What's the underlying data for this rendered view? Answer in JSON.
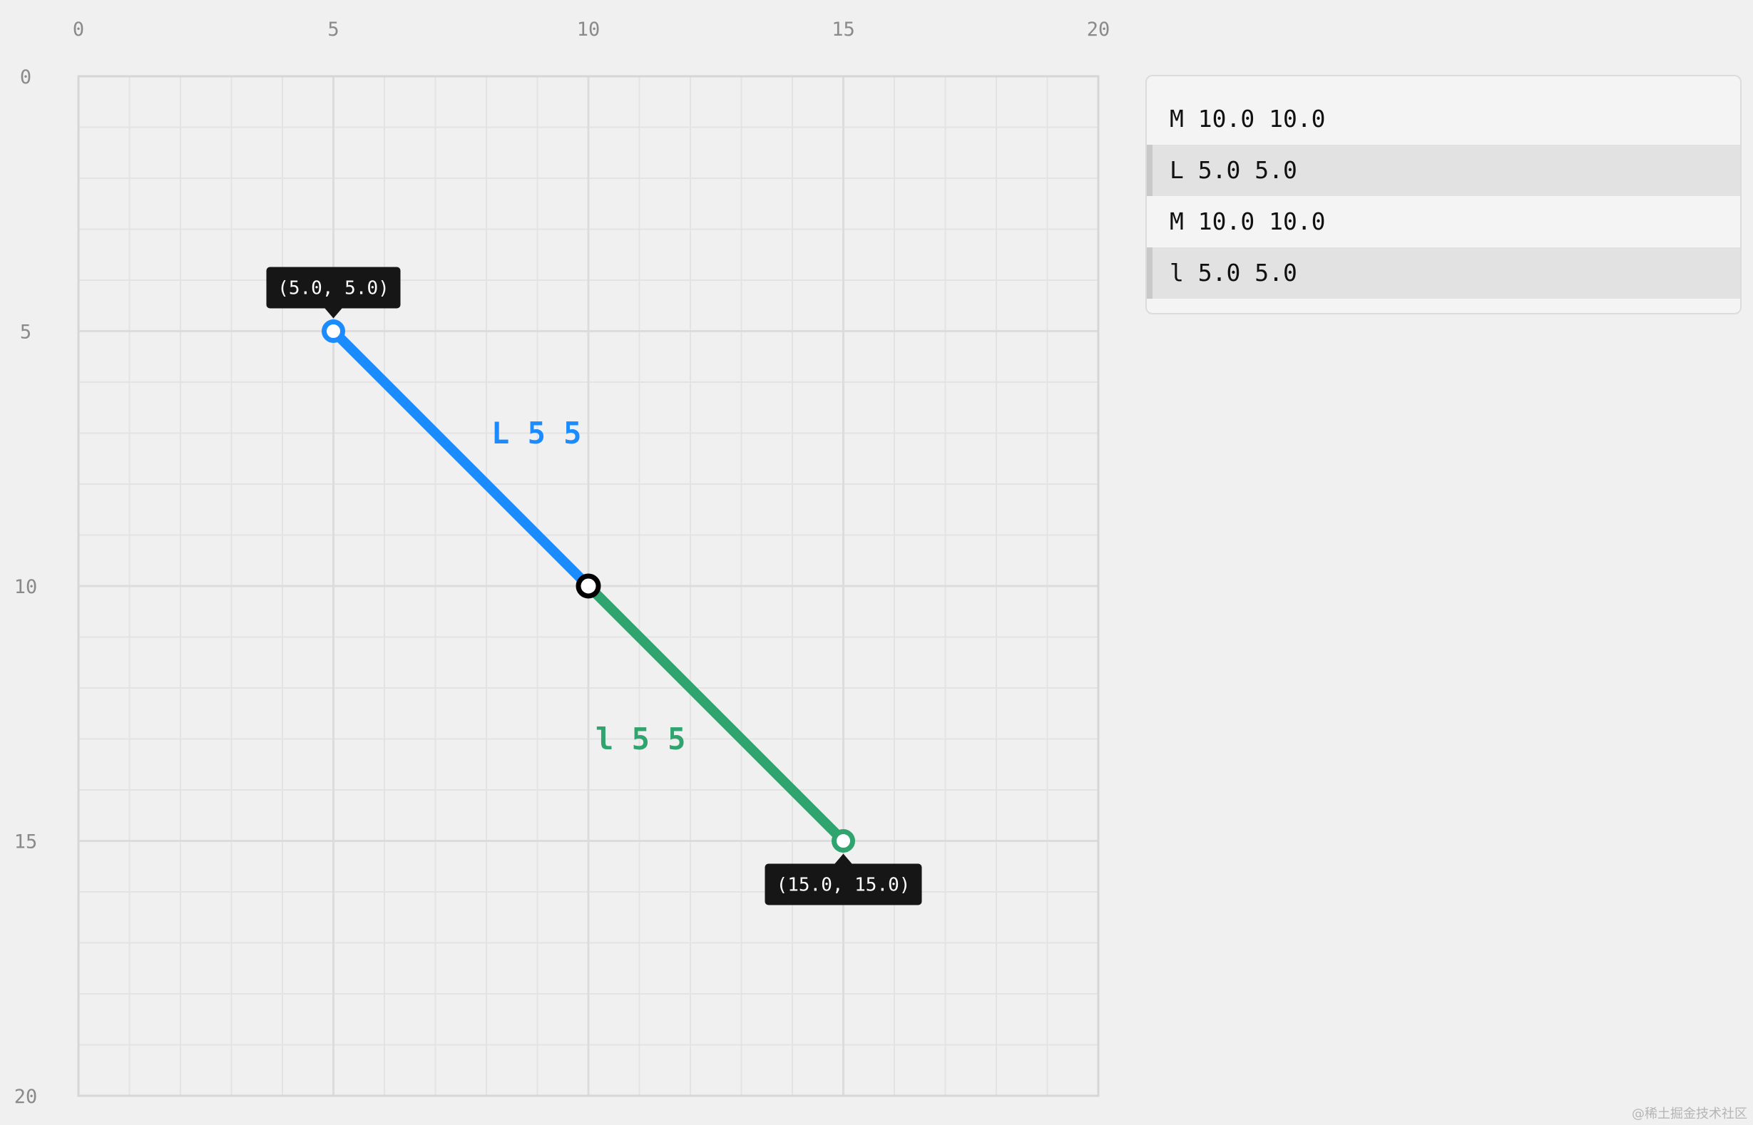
{
  "canvas": {
    "x_ticks": [
      "0",
      "5",
      "10",
      "15",
      "20"
    ],
    "y_ticks": [
      "0",
      "5",
      "10",
      "15",
      "20"
    ],
    "x_range": [
      0,
      20
    ],
    "y_range": [
      0,
      20
    ],
    "minor_step": 1,
    "major_step": 5
  },
  "path": {
    "origin": {
      "x": 10,
      "y": 10
    },
    "segments": [
      {
        "command_label": "L 5 5",
        "from": {
          "x": 10,
          "y": 10
        },
        "to": {
          "x": 5,
          "y": 5
        },
        "color": "#1a8cff",
        "tooltip": "(5.0, 5.0)"
      },
      {
        "command_label": "l 5 5",
        "from": {
          "x": 10,
          "y": 10
        },
        "to": {
          "x": 15,
          "y": 15
        },
        "color": "#2fa46e",
        "tooltip": "(15.0, 15.0)"
      }
    ],
    "origin_color": "#000000"
  },
  "commands": [
    {
      "text": "M 10.0 10.0",
      "active": false
    },
    {
      "text": "L 5.0 5.0",
      "active": true
    },
    {
      "text": "M 10.0 10.0",
      "active": false
    },
    {
      "text": "l 5.0 5.0",
      "active": true
    }
  ],
  "watermark": "@稀土掘金技术社区"
}
